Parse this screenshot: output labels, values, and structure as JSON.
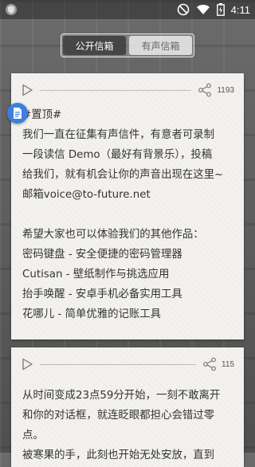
{
  "statusbar": {
    "time": "4:11",
    "icons": [
      "shield-icon",
      "dnd-icon",
      "wifi-icon",
      "battery-icon"
    ]
  },
  "tabs": [
    {
      "label": "公开信箱",
      "active": true
    },
    {
      "label": "有声信箱",
      "active": false
    }
  ],
  "cards": [
    {
      "play_count": "1193",
      "text": "#置顶#\n我们一直在征集有声信件，有意者可录制\n一段读信 Demo（最好有背景乐），投稿\n给我们，就有机会让你的声音出现在这里~\n邮箱voice@to-future.net\n\n希望大家也可以体验我们的其他作品：\n密码键盘 - 安全便捷的密码管理器\nCutisan - 壁纸制作与挑选应用\n抬手唤醒 - 安卓手机必备实用工具\n花哪儿 - 简单优雅的记账工具"
    },
    {
      "play_count": "115",
      "text": "从时间变成23点59分开始，一刻不敢离开\n和你的对话框，就连眨眼都担心会错过零\n点。\n被寒果的手，此刻也开始无处安放，直到"
    }
  ],
  "colors": {
    "badge": "#3c7fe0",
    "card_bg": "#f3f2ef"
  }
}
